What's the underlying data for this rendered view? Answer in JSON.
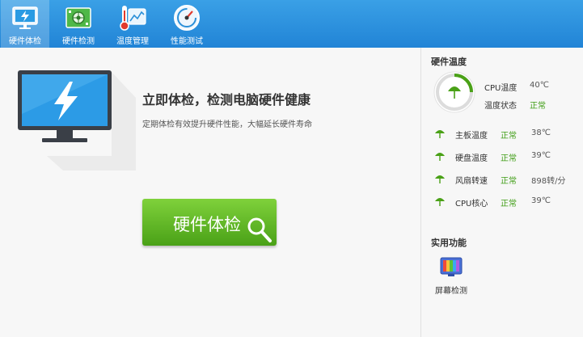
{
  "tabs": [
    {
      "label": "硬件体检",
      "icon": "monitor-icon",
      "active": true
    },
    {
      "label": "硬件检测",
      "icon": "circuit-board-icon",
      "active": false
    },
    {
      "label": "温度管理",
      "icon": "thermometer-chart-icon",
      "active": false
    },
    {
      "label": "性能测试",
      "icon": "speedometer-icon",
      "active": false
    }
  ],
  "main": {
    "headline": "立即体检，检测电脑硬件健康",
    "subline": "定期体检有效提升硬件性能，大幅延长硬件寿命",
    "check_button": "硬件体检"
  },
  "panel": {
    "temp_title": "硬件温度",
    "cpu_temp_label": "CPU温度",
    "cpu_temp_value": "40℃",
    "temp_status_label": "温度状态",
    "temp_status_value": "正常",
    "sensors": [
      {
        "name": "主板温度",
        "status": "正常",
        "value": "38℃"
      },
      {
        "name": "硬盘温度",
        "status": "正常",
        "value": "39℃"
      },
      {
        "name": "风扇转速",
        "status": "正常",
        "value": "898转/分"
      },
      {
        "name": "CPU核心",
        "status": "正常",
        "value": "39℃"
      }
    ],
    "tools_title": "实用功能",
    "tools": [
      {
        "label": "屏幕检测",
        "icon": "screen-test-icon"
      }
    ]
  },
  "colors": {
    "topbar": "#2b8fdc",
    "accent_green": "#4aa117",
    "status_ok": "#3f9d14"
  }
}
